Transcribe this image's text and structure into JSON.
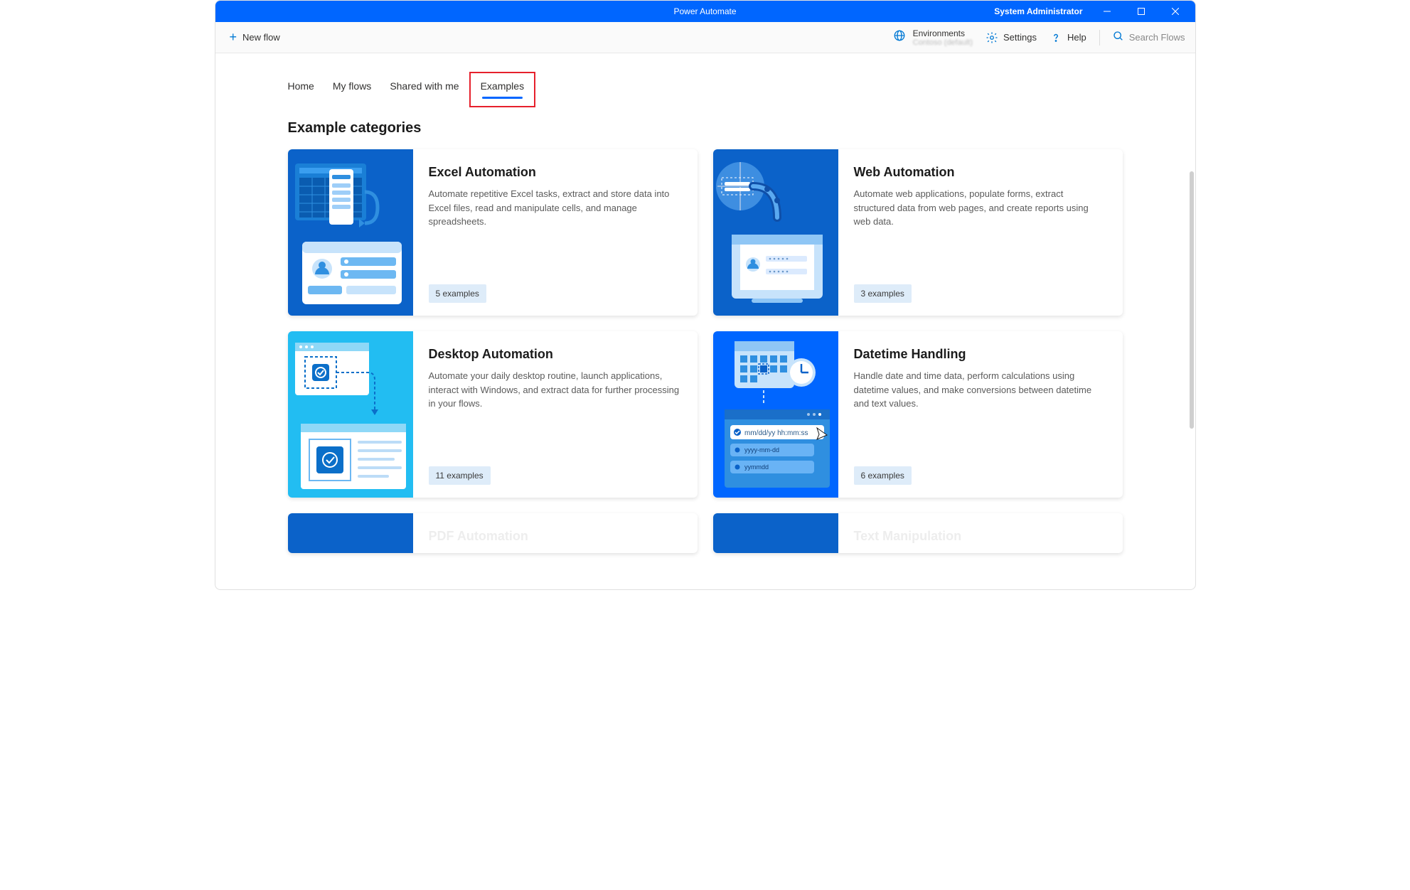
{
  "titlebar": {
    "title": "Power Automate",
    "user": "System Administrator"
  },
  "toolbar": {
    "new_flow": "New flow",
    "environments_label": "Environments",
    "environments_value": "Contoso (default)",
    "settings": "Settings",
    "help": "Help",
    "search_placeholder": "Search Flows"
  },
  "tabs": [
    "Home",
    "My flows",
    "Shared with me",
    "Examples"
  ],
  "active_tab": "Examples",
  "section_title": "Example categories",
  "cards": [
    {
      "title": "Excel Automation",
      "desc": "Automate repetitive Excel tasks, extract and store data into Excel files, read and manipulate cells, and manage spreadsheets.",
      "badge": "5 examples",
      "thumb_bg": "#0b62c9"
    },
    {
      "title": "Web Automation",
      "desc": "Automate web applications, populate forms, extract structured data from web pages, and create reports using web data.",
      "badge": "3 examples",
      "thumb_bg": "#0b62c9"
    },
    {
      "title": "Desktop Automation",
      "desc": "Automate your daily desktop routine, launch applications, interact with Windows, and extract data for further processing in your flows.",
      "badge": "11 examples",
      "thumb_bg": "#22bdf2"
    },
    {
      "title": "Datetime Handling",
      "desc": "Handle date and time data, perform calculations using datetime values, and make conversions between datetime and text values.",
      "badge": "6 examples",
      "thumb_bg": "#0066ff",
      "datetime_text_1": "mm/dd/yy hh:mm:ss",
      "datetime_text_2": "yyyy-mm-dd",
      "datetime_text_3": "yymmdd"
    },
    {
      "title_partial": "PDF Automation",
      "thumb_bg": "#0b62c9"
    },
    {
      "title_partial": "Text Manipulation",
      "thumb_bg": "#0b62c9"
    }
  ]
}
